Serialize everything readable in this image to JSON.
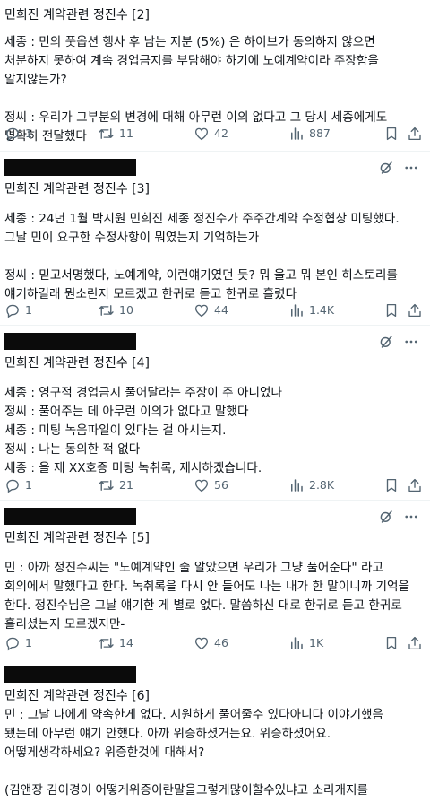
{
  "posts": [
    {
      "title": "민희진 계약관련 정진수 [2]",
      "body": "세종 : 민의 풋옵션 행사 후 남는 지분 (5%) 은 하이브가 동의하지 않으면 처분하지 못하여 계속 경업금지를 부담해야 하기에 노예계약이라 주장함을 알지않는가?\n\n정씨 : 우리가 그부분의 변경에 대해 아무런 이의 없다고 그 당시 세종에게도 명확히 전달했다",
      "replies": "1",
      "retweets": "11",
      "likes": "42",
      "views": "887"
    },
    {
      "title": "민희진 계약관련 정진수 [3]",
      "body": "세종 : 24년 1월 박지원 민희진 세종 정진수가 주주간계약 수정협상 미팅했다. 그날 민이 요구한 수정사항이 뭐였는지 기억하는가\n\n정씨 : 믿고서명했다, 노예계약, 이런얘기였던 듯? 뭐 울고 뭐 본인 히스토리를 얘기하길래 뭔소린지 모르겠고 한귀로 듣고 한귀로 흘렸다",
      "replies": "1",
      "retweets": "10",
      "likes": "44",
      "views": "1.4K"
    },
    {
      "title": "민희진 계약관련 정진수 [4]",
      "body": "세종 : 영구적 경업금지 풀어달라는 주장이 주 아니었나\n정씨 : 풀어주는 데 아무런 이의가 없다고 말했다\n세종 : 미팅 녹음파일이 있다는 걸 아시는지.\n정씨 : 나는 동의한 적 없다\n세종 : 을 제 XX호증 미팅 녹취록, 제시하겠습니다.",
      "replies": "1",
      "retweets": "21",
      "likes": "56",
      "views": "2.8K"
    },
    {
      "title": "민희진 계약관련 정진수 [5]",
      "body": "민 : 아까 정진수씨는 \"노예계약인 줄 알았으면 우리가 그냥 풀어준다\" 라고 회의에서 말했다고 한다. 녹취록을 다시 안 들어도 나는 내가 한 말이니까 기억을 한다. 정진수님은 그날 얘기한 게 별로 없다. 말씀하신 대로 한귀로 듣고 한귀로 흘리셨는지 모르겠지만-",
      "replies": "1",
      "retweets": "14",
      "likes": "46",
      "views": "1K"
    },
    {
      "title": "민희진 계약관련 정진수 [6]",
      "body": "민 : 그날 나에게 약속한게 없다. 시원하게 풀어줄수 있다아니다 이야기했음 됐는데 아무런 얘기 안했다. 아까 위증하셨거든요. 위증하셨어요. 어떻게생각하세요? 위증한것에 대해서?\n\n(김앤장 김이경이 어떻게위증이란말을그렇게많이할수있냐고 소리개지를 당떨어지신듯)"
    }
  ],
  "icons": {
    "reply": "reply-bubble-icon",
    "retweet": "retweet-icon",
    "like": "heart-icon",
    "views": "views-bar-chart-icon",
    "bookmark": "bookmark-icon",
    "share": "share-icon",
    "grok": "grok-slash-icon",
    "more": "more-dots-icon"
  },
  "colors": {
    "icon": "#536471",
    "text": "#0f1419",
    "divider": "#eff3f4",
    "redaction": "#0b0b0b"
  }
}
